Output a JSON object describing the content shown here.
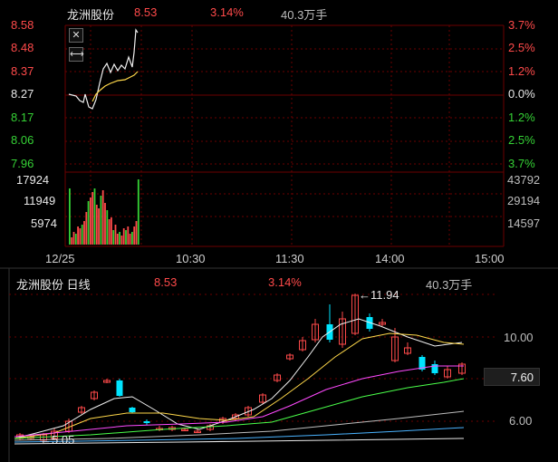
{
  "intraday": {
    "title": "龙洲股份",
    "price": "8.53",
    "change_pct": "3.14%",
    "volume": "40.3万手",
    "price_axis_left": [
      "8.58",
      "8.48",
      "8.37",
      "8.27",
      "8.17",
      "8.06",
      "7.96"
    ],
    "pct_axis_right": [
      "3.7%",
      "2.5%",
      "1.2%",
      "0.0%",
      "1.2%",
      "2.5%",
      "3.7%"
    ],
    "vol_axis_left": [
      "17924",
      "11949",
      "5974"
    ],
    "vol_axis_right": [
      "43792",
      "29194",
      "14597"
    ],
    "time_axis": [
      "12/25",
      "10:30",
      "11:30",
      "14:00",
      "15:00"
    ],
    "close_icon": "close-icon",
    "expand_icon": "expand-horizontal-icon"
  },
  "daily": {
    "title": "龙洲股份 日线",
    "price": "8.53",
    "change_pct": "3.14%",
    "volume": "40.3万手",
    "axis": [
      "10.00",
      "6.00"
    ],
    "current_price_tag": "7.60",
    "high_annotation": "11.94",
    "low_annotation": "5.05"
  },
  "colors": {
    "up": "#ff4a4a",
    "down": "#35d135",
    "bear_candle": "#00e5ff",
    "grid": "#6b0000"
  }
}
